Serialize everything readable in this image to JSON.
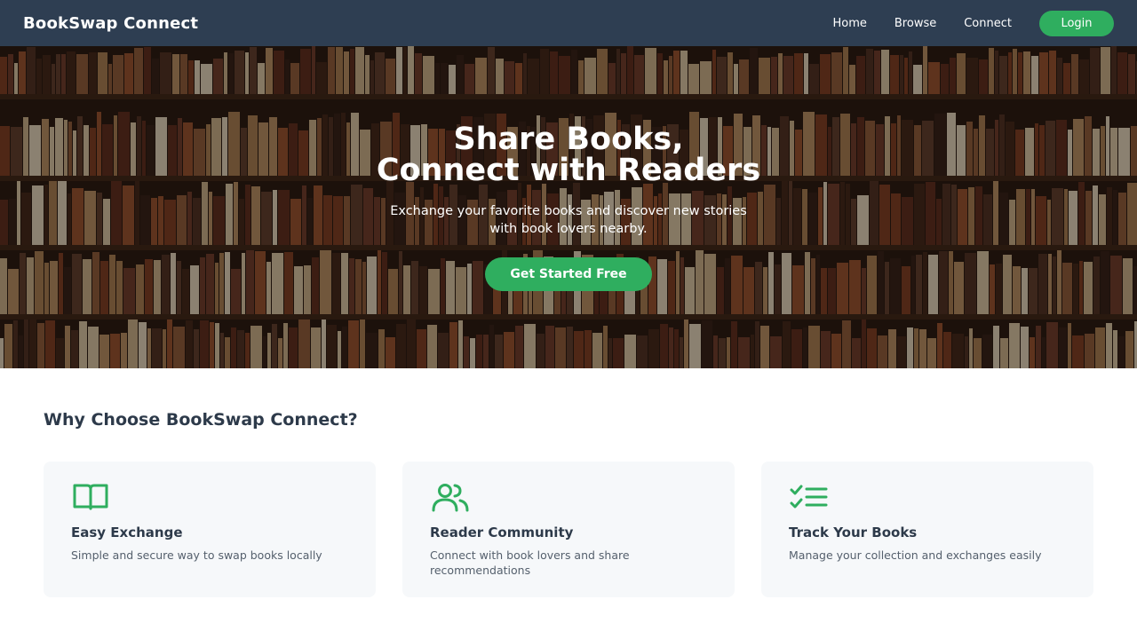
{
  "navbar": {
    "brand": "BookSwap Connect",
    "links": [
      "Home",
      "Browse",
      "Connect"
    ],
    "login_label": "Login"
  },
  "hero": {
    "title_line1": "Share Books,",
    "title_line2": "Connect with Readers",
    "subtitle_line1": "Exchange your favorite books and discover new stories",
    "subtitle_line2": "with book lovers nearby.",
    "cta_label": "Get Started Free"
  },
  "features": {
    "heading": "Why Choose BookSwap Connect?",
    "cards": [
      {
        "icon": "open-book-icon",
        "title": "Easy Exchange",
        "description": "Simple and secure way to swap books locally"
      },
      {
        "icon": "users-icon",
        "title": "Reader Community",
        "description": "Connect with book lovers and share recommendations"
      },
      {
        "icon": "checklist-icon",
        "title": "Track Your Books",
        "description": "Manage your collection and exchanges easily"
      }
    ]
  },
  "colors": {
    "navbar": "#2e3e52",
    "accent": "#2fae5f",
    "card_bg": "#f6f8fa",
    "heading": "#2d3a4a"
  }
}
